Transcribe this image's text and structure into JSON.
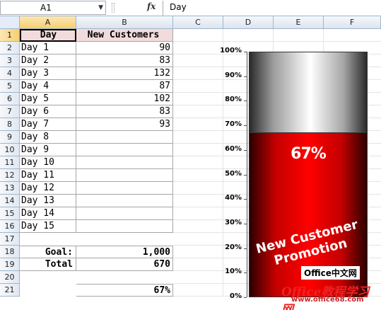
{
  "formula_bar": {
    "name_box": "A1",
    "fx_label": "fx",
    "content": "Day"
  },
  "columns": [
    "A",
    "B",
    "C",
    "D",
    "E",
    "F"
  ],
  "selected_column": "A",
  "rows": [
    "1",
    "2",
    "3",
    "4",
    "5",
    "6",
    "7",
    "8",
    "9",
    "10",
    "11",
    "12",
    "13",
    "14",
    "15",
    "16",
    "17",
    "18",
    "19",
    "20",
    "21"
  ],
  "table": {
    "headers": {
      "day": "Day",
      "customers": "New Customers"
    },
    "days": [
      "Day 1",
      "Day 2",
      "Day 3",
      "Day 4",
      "Day 5",
      "Day 6",
      "Day 7",
      "Day 8",
      "Day 9",
      "Day 10",
      "Day 11",
      "Day 12",
      "Day 13",
      "Day 14",
      "Day 15"
    ],
    "values": [
      "90",
      "83",
      "132",
      "87",
      "102",
      "83",
      "93",
      "",
      "",
      "",
      "",
      "",
      "",
      "",
      ""
    ]
  },
  "summary": {
    "goal_label": "Goal:",
    "goal_value": "1,000",
    "total_label": "Total",
    "total_value": "670",
    "percent": "67%"
  },
  "chart_data": {
    "type": "bar",
    "title": "New Customer Promotion",
    "categories": [
      ""
    ],
    "values": [
      0.67
    ],
    "data_label": "67%",
    "ylim": [
      0,
      1
    ],
    "yticks": [
      "0%",
      "10%",
      "20%",
      "30%",
      "40%",
      "50%",
      "60%",
      "70%",
      "80%",
      "90%",
      "100%"
    ],
    "colors": {
      "fill": "#ff0000",
      "empty": "#ffffff"
    }
  },
  "watermark": {
    "line1": "Office中文网",
    "line2": "Office教程学习网",
    "line3": "www.office68.com"
  }
}
